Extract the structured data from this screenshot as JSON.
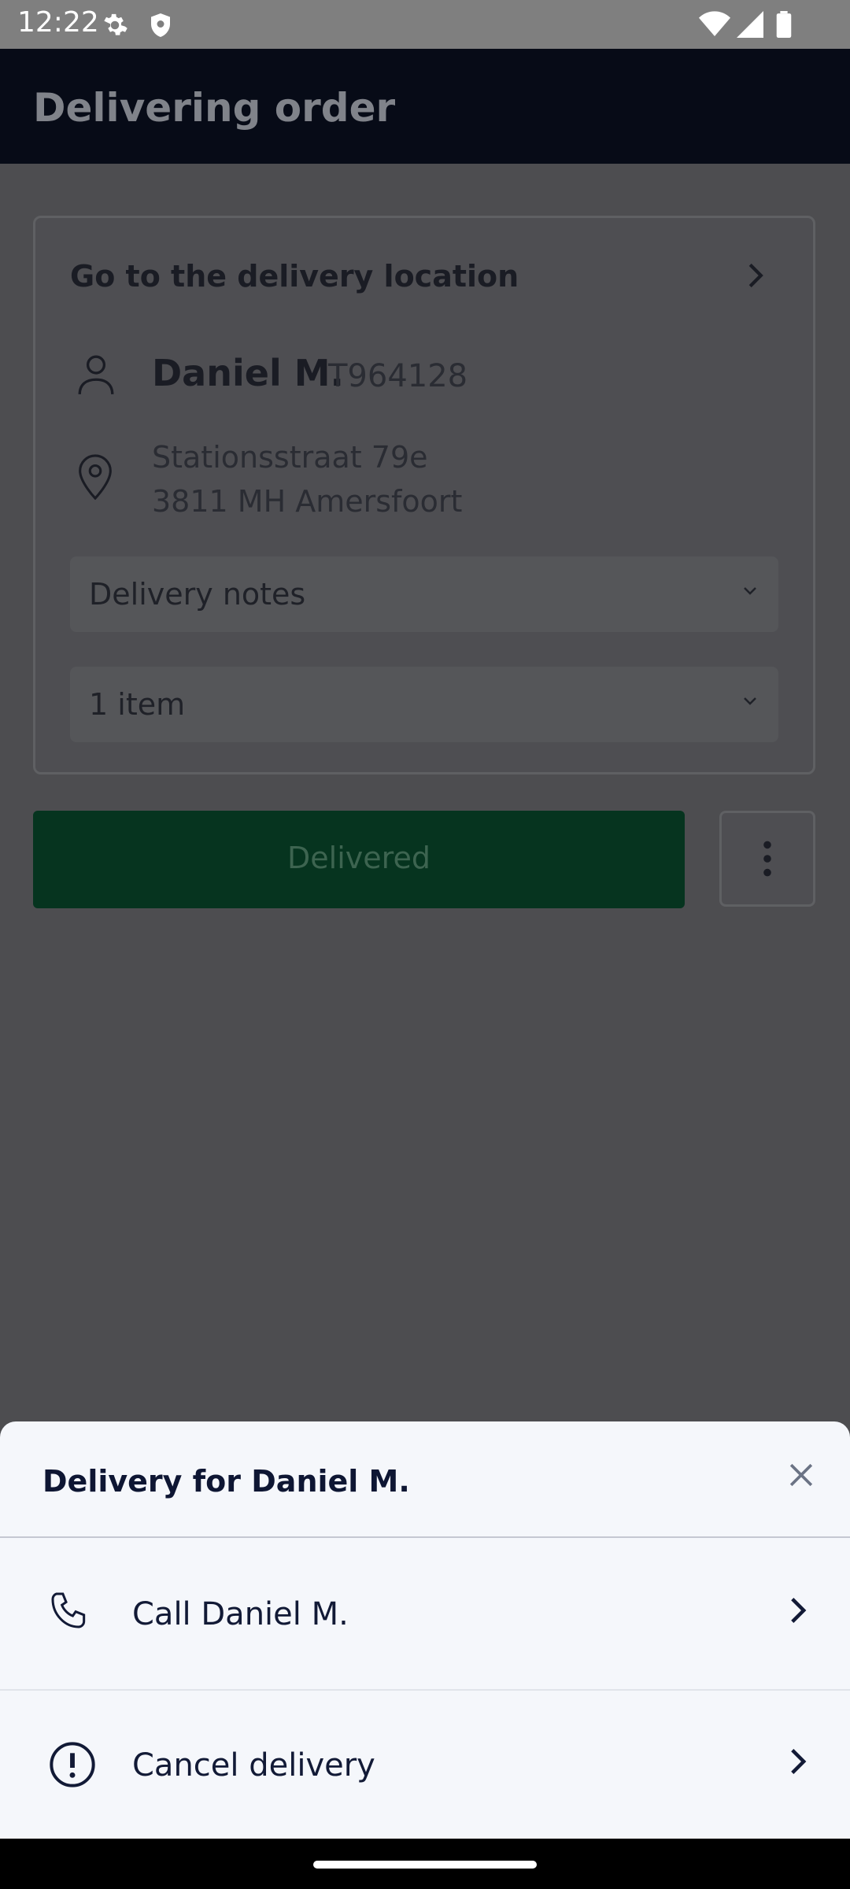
{
  "status_bar": {
    "time": "12:22",
    "icons": [
      "settings-gear-icon",
      "shield-icon",
      "wifi-icon",
      "signal-icon",
      "battery-icon"
    ]
  },
  "app_bar": {
    "title": "Delivering order"
  },
  "card": {
    "heading": "Go to the delivery location",
    "customer_name": "Daniel M.",
    "order_code": "T964128",
    "address_line1": "Stationsstraat 79e",
    "address_line2": "3811 MH  Amersfoort",
    "delivery_notes_label": "Delivery notes",
    "items_label": "1 item"
  },
  "actions": {
    "delivered_label": "Delivered"
  },
  "bottom_sheet": {
    "title": "Delivery for Daniel M.",
    "items": [
      {
        "label": "Call Daniel M.",
        "icon": "phone-icon"
      },
      {
        "label": "Cancel delivery",
        "icon": "alert-circle-icon"
      }
    ]
  },
  "colors": {
    "accent_green": "#06341f",
    "sheet_background": "#f5f7fb",
    "text_dark": "#0e1633"
  }
}
